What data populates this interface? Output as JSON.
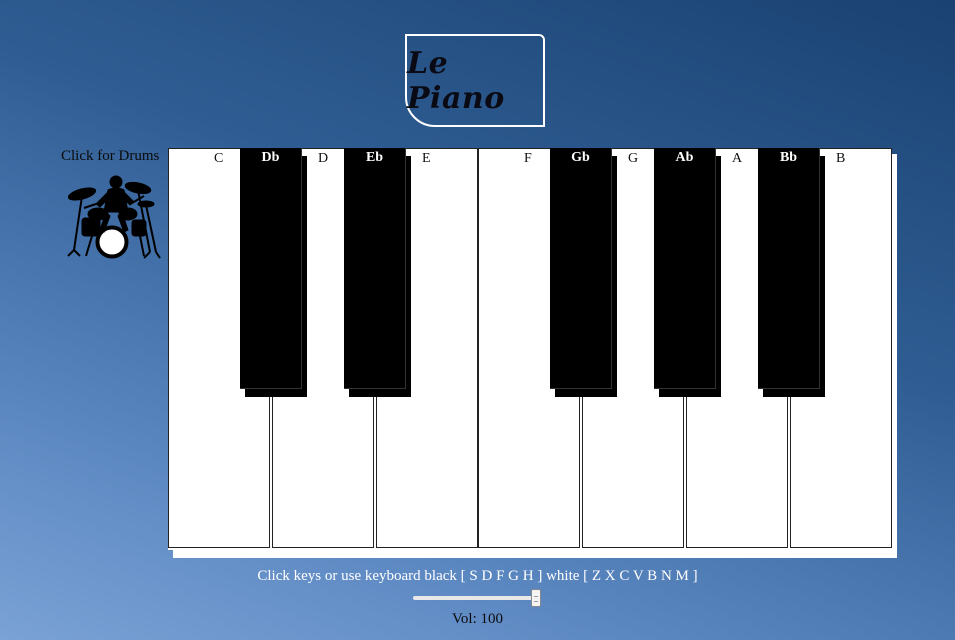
{
  "title": "Le Piano",
  "drums": {
    "label": "Click for Drums",
    "icon": "drummer-icon"
  },
  "piano": {
    "white_keys": [
      "C",
      "D",
      "E",
      "F",
      "G",
      "A",
      "B"
    ],
    "black_keys": [
      "Db",
      "Eb",
      "Gb",
      "Ab",
      "Bb"
    ]
  },
  "instructions": "Click keys or use keyboard black [ S D F G H ] white [ Z X C V B N M ]",
  "volume": {
    "label": "Vol: 100",
    "value": 100,
    "max": 100
  }
}
